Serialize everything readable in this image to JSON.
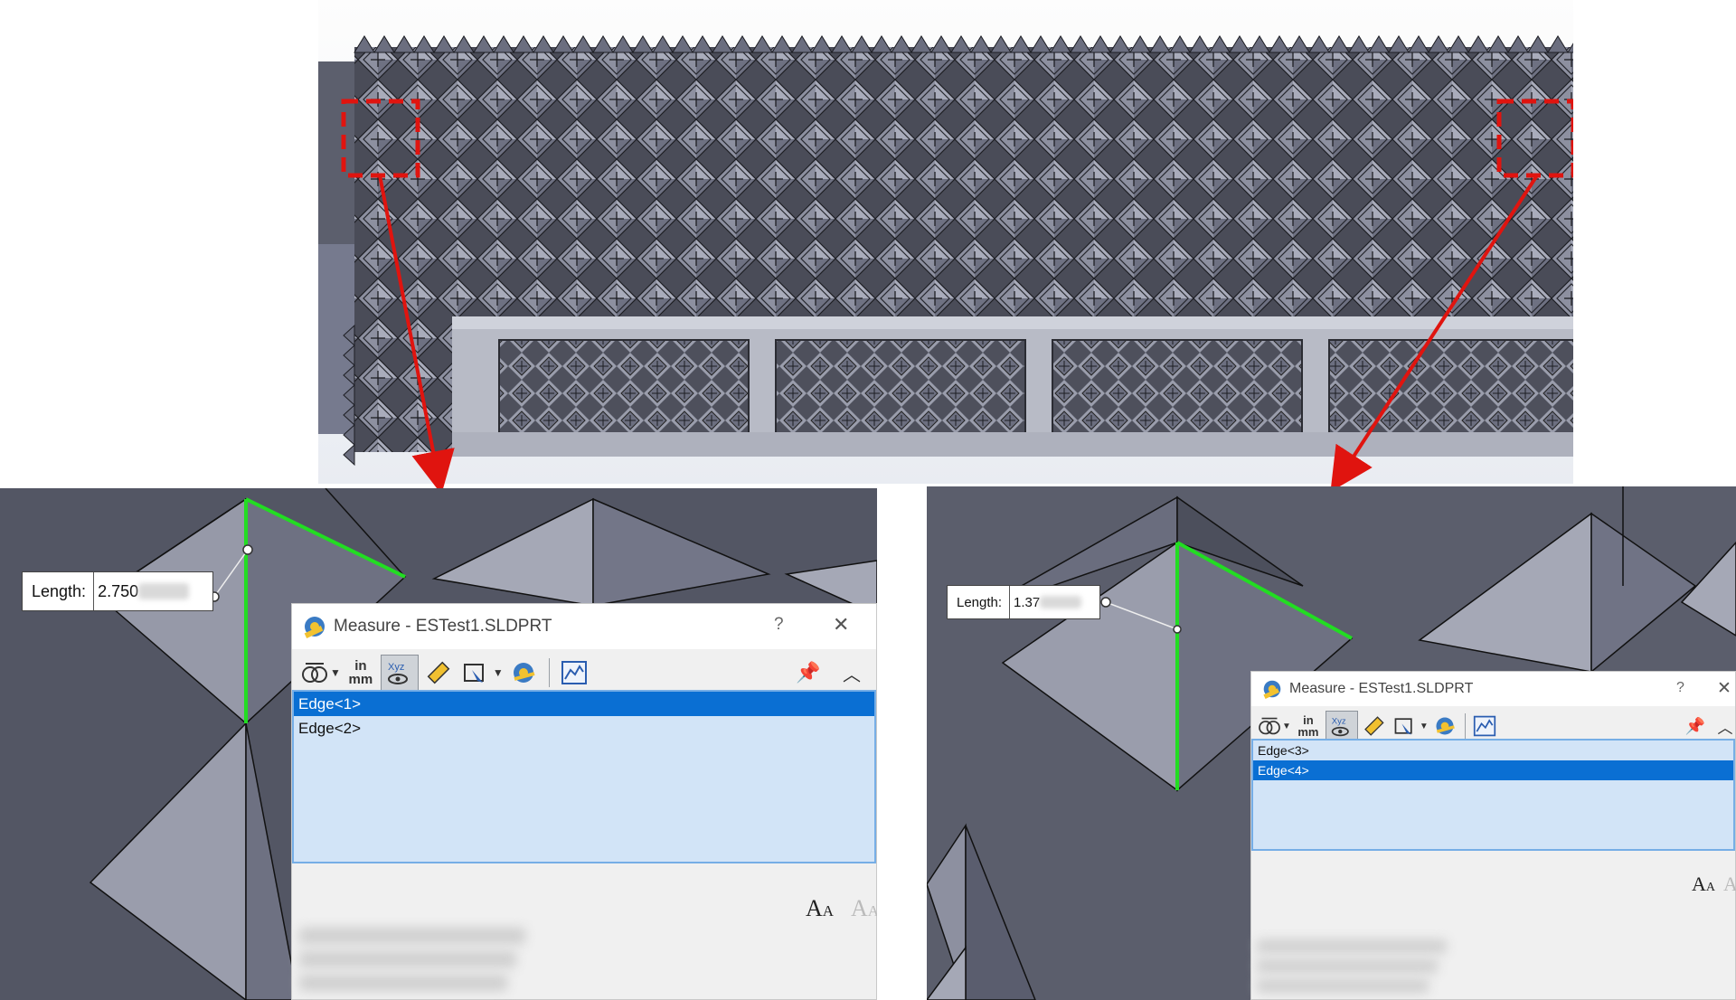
{
  "left_panel": {
    "length_label": "Length:",
    "length_value": "2.750",
    "dialog": {
      "title": "Measure - ESTest1.SLDPRT",
      "help": "?",
      "close": "✕",
      "toolbar": {
        "units_top": "in",
        "units_bottom": "mm"
      },
      "selections": [
        "Edge<1>",
        "Edge<2>"
      ],
      "selected_index": 0
    }
  },
  "right_panel": {
    "length_label": "Length:",
    "length_value": "1.37",
    "dialog": {
      "title": "Measure - ESTest1.SLDPRT",
      "help": "?",
      "close": "✕",
      "toolbar": {
        "units_top": "in",
        "units_bottom": "mm"
      },
      "selections": [
        "Edge<3>",
        "Edge<4>"
      ],
      "selected_index": 1
    }
  },
  "icons": [
    "arc-options-icon",
    "units-icon",
    "xyz-dimensions-icon",
    "point-to-point-icon",
    "projection-icon",
    "measure-history-icon",
    "sensor-icon",
    "pin-icon",
    "collapse-icon",
    "increase-font-icon",
    "decrease-font-icon"
  ],
  "colors": {
    "edge_highlight": "#22dd22",
    "callout_arrow": "#e0140f",
    "selection_blue": "#0a6fd3",
    "list_background": "#d2e4f7",
    "model_face": "#5a5d6b"
  }
}
